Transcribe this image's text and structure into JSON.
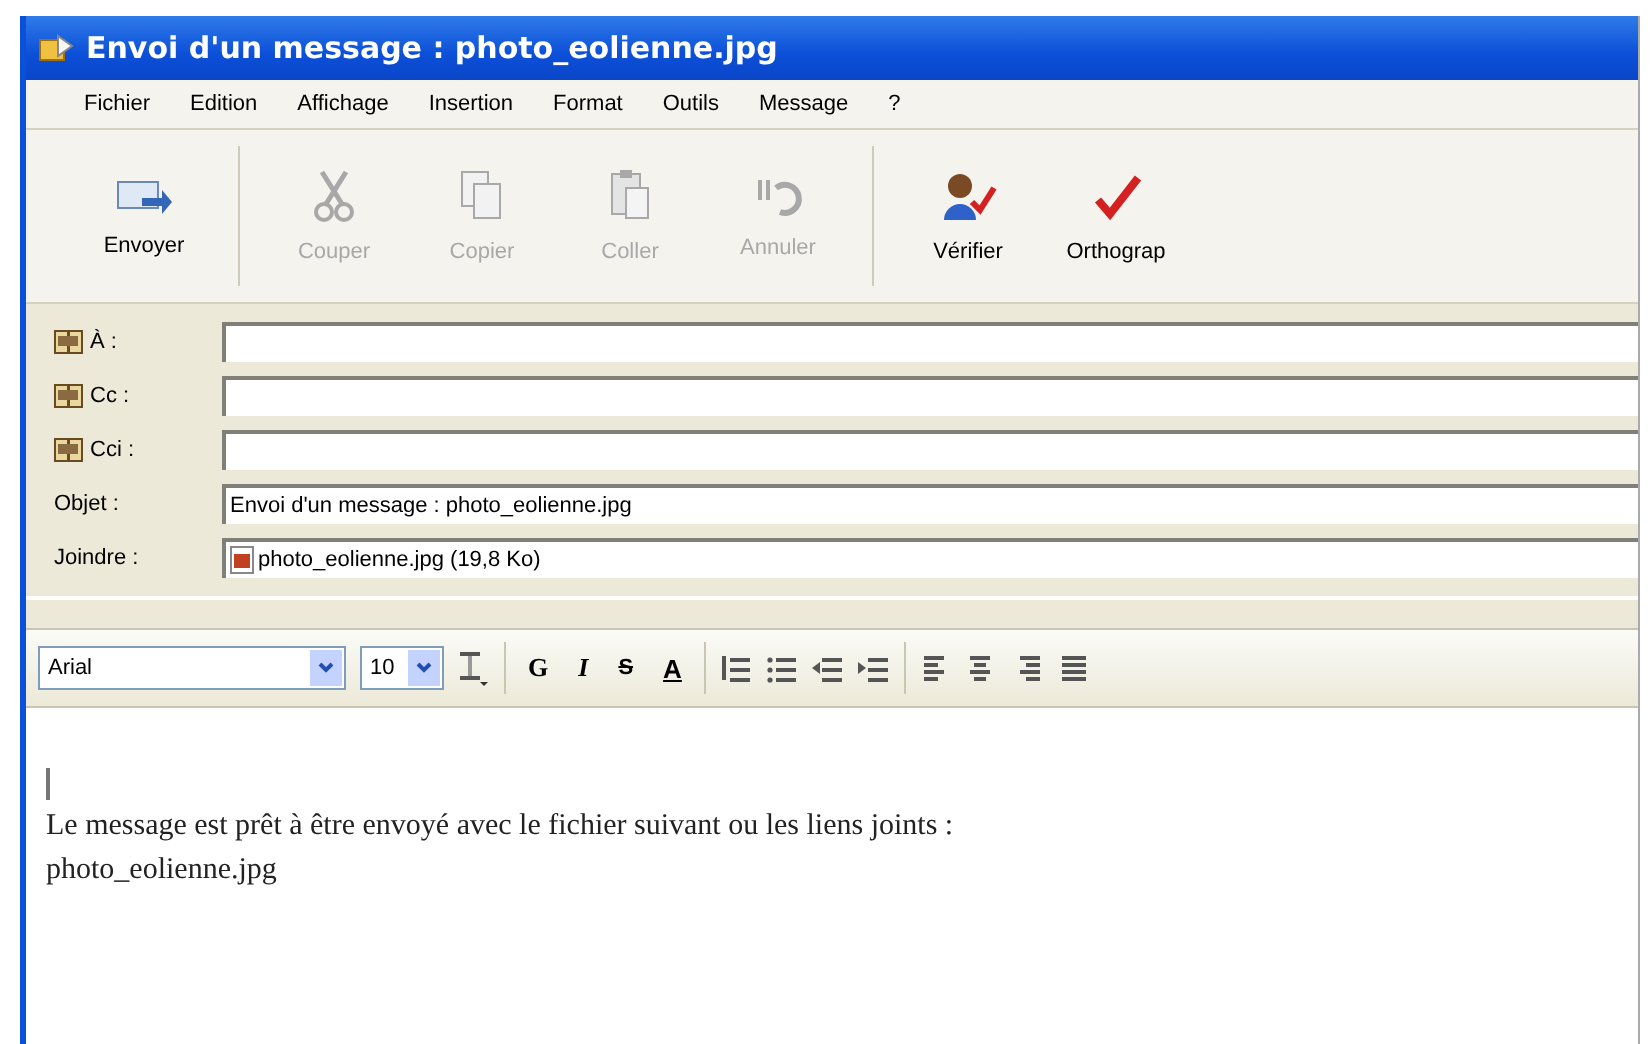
{
  "window": {
    "title": "Envoi d'un message : photo_eolienne.jpg"
  },
  "menu": [
    "Fichier",
    "Edition",
    "Affichage",
    "Insertion",
    "Format",
    "Outils",
    "Message",
    "?"
  ],
  "toolbar": [
    {
      "kind": "send",
      "label": "Envoyer",
      "disabled": false
    },
    {
      "kind": "cut",
      "label": "Couper",
      "disabled": true
    },
    {
      "kind": "copy",
      "label": "Copier",
      "disabled": true
    },
    {
      "kind": "paste",
      "label": "Coller",
      "disabled": true
    },
    {
      "kind": "undo",
      "label": "Annuler",
      "disabled": true
    },
    {
      "kind": "check",
      "label": "Vérifier",
      "disabled": false
    },
    {
      "kind": "spell",
      "label": "Orthograp",
      "disabled": false
    }
  ],
  "header": [
    {
      "kind": "address",
      "label": "À :"
    },
    {
      "kind": "address",
      "label": "Cc :"
    },
    {
      "kind": "address",
      "label": "Cci :"
    },
    {
      "kind": "text",
      "label": "Objet :",
      "value": "Envoi d'un message : photo_eolienne.jpg"
    },
    {
      "kind": "attach",
      "label": "Joindre :",
      "value": "photo_eolienne.jpg (19,8 Ko)"
    }
  ],
  "format_bar": {
    "font": "Arial",
    "size": "10",
    "style_buttons": [
      {
        "kind": "bold",
        "label": "G"
      },
      {
        "kind": "italic",
        "label": "I"
      },
      {
        "kind": "strike",
        "label": "S"
      },
      {
        "kind": "color",
        "label": "A"
      }
    ]
  },
  "body": {
    "lines": [
      "Le message est prêt à être envoyé avec le fichier suivant ou les liens joints :",
      "photo_eolienne.jpg"
    ]
  }
}
